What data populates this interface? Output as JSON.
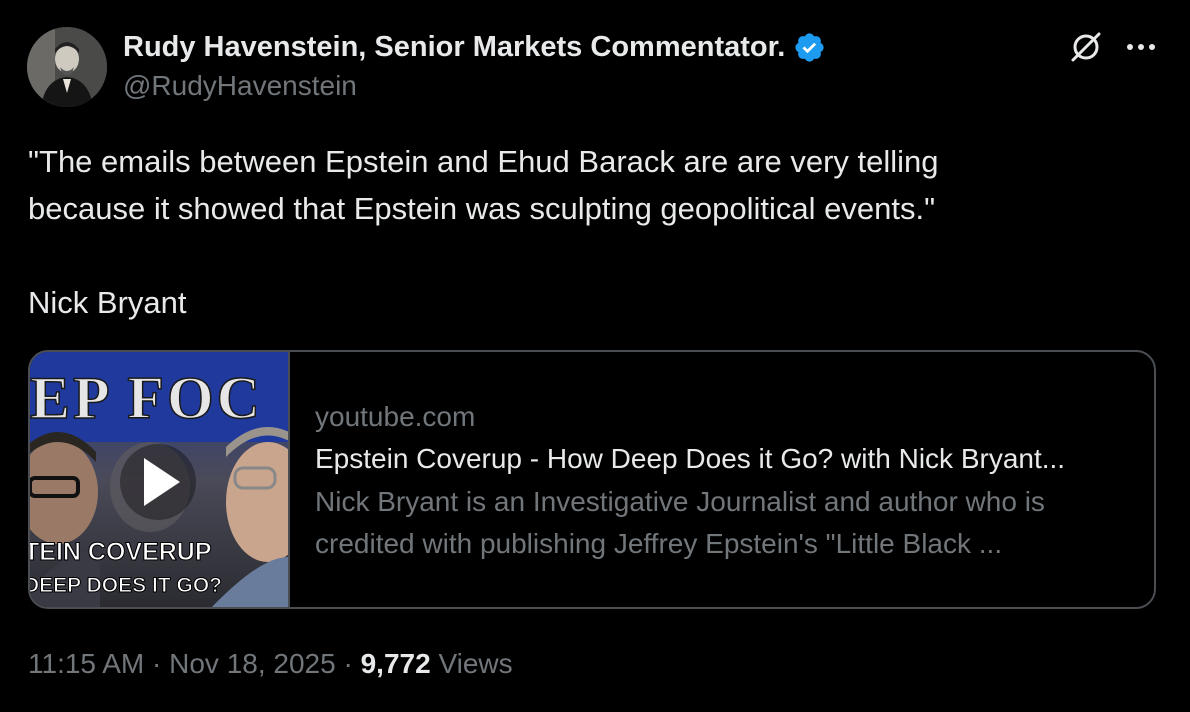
{
  "author": {
    "display_name": "Rudy Havenstein, Senior Markets Commentator.",
    "handle": "@RudyHavenstein",
    "avatar_icon": "portrait-avatar",
    "verified_icon": "verified-badge-icon",
    "verified_color": "#1d9bf0"
  },
  "actions": {
    "grok_icon": "grok-icon",
    "more_icon": "more-options-icon"
  },
  "tweet": {
    "lines": [
      "\"The emails between Epstein and Ehud Barack are are very telling",
      "because it showed that Epstein was sculpting geopolitical events.\"",
      "",
      "Nick Bryant"
    ]
  },
  "card": {
    "domain": "youtube.com",
    "title": "Epstein Coverup - How Deep Does it Go? with Nick Bryant...",
    "description_lines": [
      "Nick Bryant is an Investigative Journalist and author who is",
      "credited with publishing Jeffrey Epstein's \"Little Black ..."
    ],
    "thumbnail": {
      "top_text": "EP FOC",
      "caption_line1": "TEIN COVERUP",
      "caption_line2": "DEEP DOES IT GO?",
      "play_icon": "play-icon"
    }
  },
  "meta": {
    "time": "11:15 AM",
    "separator": "·",
    "date": "Nov 18, 2025",
    "views_count": "9,772",
    "views_label": "Views"
  },
  "colors": {
    "background": "#000000",
    "primary_text": "#e7e9ea",
    "secondary_text": "#71767b",
    "border": "#4a4e52",
    "verified": "#1d9bf0"
  }
}
